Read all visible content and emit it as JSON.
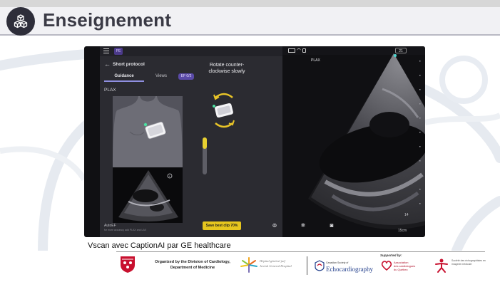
{
  "slide": {
    "title": "Enseignement",
    "caption": "Vscan avec CaptionAI par GE healthcare"
  },
  "app": {
    "left_panel": {
      "badge": "PE",
      "back_symbol": "←",
      "protocol_title": "Short protocol",
      "tabs": [
        {
          "label": "Guidance",
          "active": true
        },
        {
          "label": "Views",
          "active": false
        }
      ],
      "tab_badge": "EF 0/2",
      "view_label": "PLAX",
      "file_name": "AutoEF",
      "file_description": "for more accuracy add PLAX and LAX"
    },
    "guidance": {
      "instruction": "Rotate counter-clockwise slowly",
      "quality_level": 0.3,
      "save_button": "Save best clip 70%"
    },
    "scan": {
      "view_label": "PLAX",
      "status_badge": "21",
      "depth": "15cm",
      "scale_mark": "14"
    }
  },
  "sponsors": {
    "organizer": "Organized by the Division of Cardiology, Department of Medicine",
    "jgh": [
      "Hôpital général juif",
      "Jewish General Hospital"
    ],
    "ccs_small": "Canadian Society of",
    "ccs_big": "Echocardiography",
    "supported_by": "Supported by:",
    "association": [
      "Association",
      "des cardiologues",
      "du Québec"
    ],
    "society": "Société des échographistes en imagerie médicale"
  },
  "colors": {
    "header_bg": "#f1f1f4",
    "title": "#3a3a45",
    "save_button": "#e6c61e",
    "active_tab": "#8f8fe0"
  }
}
